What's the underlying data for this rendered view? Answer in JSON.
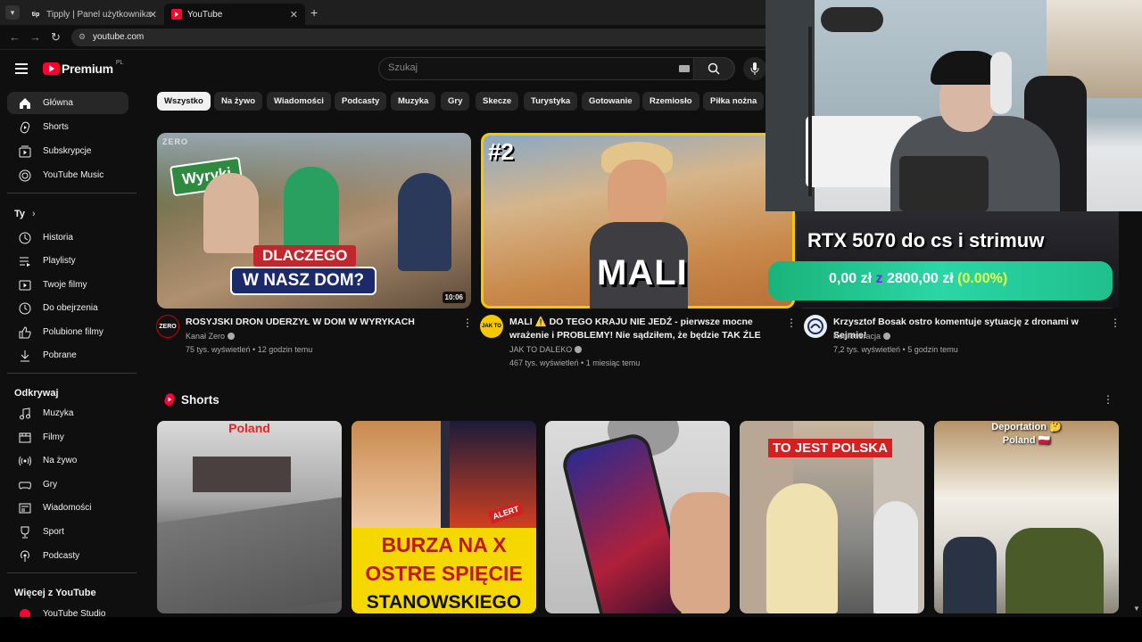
{
  "browser": {
    "tabs": [
      {
        "title": "Tipply | Panel użytkownika",
        "favicon": "tip"
      },
      {
        "title": "YouTube",
        "favicon": "youtube-icon"
      }
    ],
    "url": "youtube.com"
  },
  "header": {
    "logo_text": "Premium",
    "logo_region": "PL",
    "search_placeholder": "Szukaj"
  },
  "sidebar": {
    "main": [
      {
        "label": "Główna",
        "icon": "home-icon"
      },
      {
        "label": "Shorts",
        "icon": "shorts-icon"
      },
      {
        "label": "Subskrypcje",
        "icon": "subscriptions-icon"
      },
      {
        "label": "YouTube Music",
        "icon": "music-icon"
      }
    ],
    "you_heading": "Ty",
    "you": [
      {
        "label": "Historia",
        "icon": "history-icon"
      },
      {
        "label": "Playlisty",
        "icon": "playlist-icon"
      },
      {
        "label": "Twoje filmy",
        "icon": "your-videos-icon"
      },
      {
        "label": "Do obejrzenia",
        "icon": "watch-later-icon"
      },
      {
        "label": "Polubione filmy",
        "icon": "like-icon"
      },
      {
        "label": "Pobrane",
        "icon": "download-icon"
      }
    ],
    "explore_heading": "Odkrywaj",
    "explore": [
      {
        "label": "Muzyka",
        "icon": "music-note-icon"
      },
      {
        "label": "Filmy",
        "icon": "film-icon"
      },
      {
        "label": "Na żywo",
        "icon": "live-icon"
      },
      {
        "label": "Gry",
        "icon": "gaming-icon"
      },
      {
        "label": "Wiadomości",
        "icon": "news-icon"
      },
      {
        "label": "Sport",
        "icon": "trophy-icon"
      },
      {
        "label": "Podcasty",
        "icon": "podcast-icon"
      }
    ],
    "more_heading": "Więcej z YouTube",
    "more": [
      {
        "label": "YouTube Studio",
        "icon": "studio-icon"
      }
    ]
  },
  "chips": [
    "Wszystko",
    "Na żywo",
    "Wiadomości",
    "Podcasty",
    "Muzyka",
    "Gry",
    "Skecze",
    "Turystyka",
    "Gotowanie",
    "Rzemiosło",
    "Piłka nożna"
  ],
  "videos": [
    {
      "title": "ROSYJSKI DRON UDERZYŁ W DOM W WYRYKACH",
      "channel": "Kanał Zero",
      "views": "75 tys. wyświetleń",
      "age": "12 godzin temu",
      "duration": "10:06",
      "thumb_text_1": "Wyryki",
      "thumb_text_2": "DLACZEGO",
      "thumb_text_3": "W NASZ DOM?",
      "thumb_brand": "ZERO",
      "avatar_text": "ZERO"
    },
    {
      "title": "MALI ⚠️ DO TEGO KRAJU NIE JEDŹ - pierwsze mocne wrażenie i PROBLEMY! Nie sądziłem, że będzie TAK ŹLE",
      "channel": "JAK TO DALEKO",
      "views": "467 tys. wyświetleń",
      "age": "1 miesiąc temu",
      "thumb_text_1": "#2",
      "thumb_text_2": "MALI",
      "avatar_text": "JAK TO"
    },
    {
      "title": "Krzysztof Bosak ostro komentuje sytuację z dronami w Sejmie!",
      "channel": "Konfederacja",
      "views": "7,2 tys. wyświetleń",
      "age": "5 godzin temu"
    }
  ],
  "donation_overlay": {
    "title": "RTX 5070 do cs i strimuw",
    "current": "0,00 zł",
    "separator": "z",
    "goal": "2800,00 zł",
    "percent": "(0.00%)",
    "progress": 0
  },
  "shorts_section": {
    "heading": "Shorts",
    "items": [
      {
        "caption": "Poland"
      },
      {
        "caption_1": "ALERT",
        "caption_2": "BURZA NA X",
        "caption_3": "OSTRE SPIĘCIE",
        "caption_4": "STANOWSKIEGO"
      },
      {
        "caption": ""
      },
      {
        "caption": "TO JEST POLSKA"
      },
      {
        "caption_1": "Deportation 🤔",
        "caption_2": "Poland 🇵🇱"
      }
    ]
  },
  "colors": {
    "background": "#0f0f0f",
    "brand_red": "#ff0033",
    "chip": "#272727",
    "donation_green": "#22c07a"
  }
}
